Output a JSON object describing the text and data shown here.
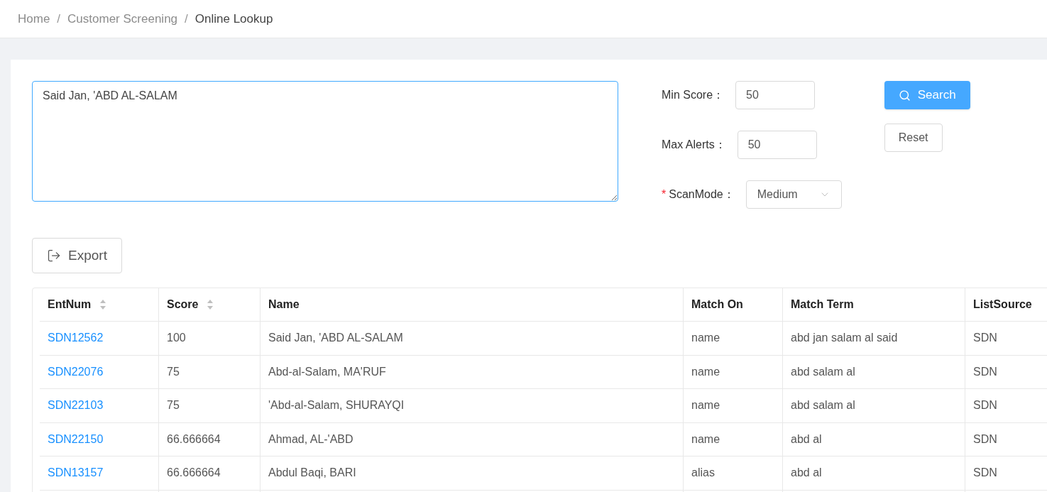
{
  "breadcrumb_separator": "/",
  "label_suffix": "：",
  "required_mark": "*",
  "breadcrumb": [
    {
      "label": "Home",
      "current": false
    },
    {
      "label": "Customer Screening",
      "current": false
    },
    {
      "label": "Online Lookup",
      "current": true
    }
  ],
  "query": {
    "value": "Said Jan, 'ABD AL-SALAM"
  },
  "form": [
    {
      "kind": "input",
      "label": "Min Score",
      "value": "50",
      "required": false
    },
    {
      "kind": "input",
      "label": "Max Alerts",
      "value": "50",
      "required": false
    },
    {
      "kind": "select",
      "label": "ScanMode",
      "value": "Medium",
      "required": true
    }
  ],
  "buttons": [
    {
      "label": "Search",
      "kind": "primary"
    },
    {
      "label": "Reset",
      "kind": "default"
    }
  ],
  "export_button": {
    "label": "Export"
  },
  "table": {
    "columns": [
      {
        "label": "EntNum",
        "sortable": true
      },
      {
        "label": "Score",
        "sortable": true
      },
      {
        "label": "Name",
        "sortable": false
      },
      {
        "label": "Match On",
        "sortable": false
      },
      {
        "label": "Match Term",
        "sortable": false
      },
      {
        "label": "ListSource",
        "sortable": false
      }
    ],
    "rows": [
      [
        "SDN12562",
        "100",
        "Said Jan, 'ABD AL-SALAM",
        "name",
        "abd jan salam al said",
        "SDN"
      ],
      [
        "SDN22076",
        "75",
        "Abd-al-Salam, MA'RUF",
        "name",
        "abd salam al",
        "SDN"
      ],
      [
        "SDN22103",
        "75",
        "'Abd-al-Salam, SHURAYQI",
        "name",
        "abd salam al",
        "SDN"
      ],
      [
        "SDN22150",
        "66.666664",
        "Ahmad, AL-'ABD",
        "name",
        "abd al",
        "SDN"
      ],
      [
        "SDN13157",
        "66.666664",
        "Abdul Baqi, BARI",
        "alias",
        "abd al",
        "SDN"
      ]
    ]
  }
}
